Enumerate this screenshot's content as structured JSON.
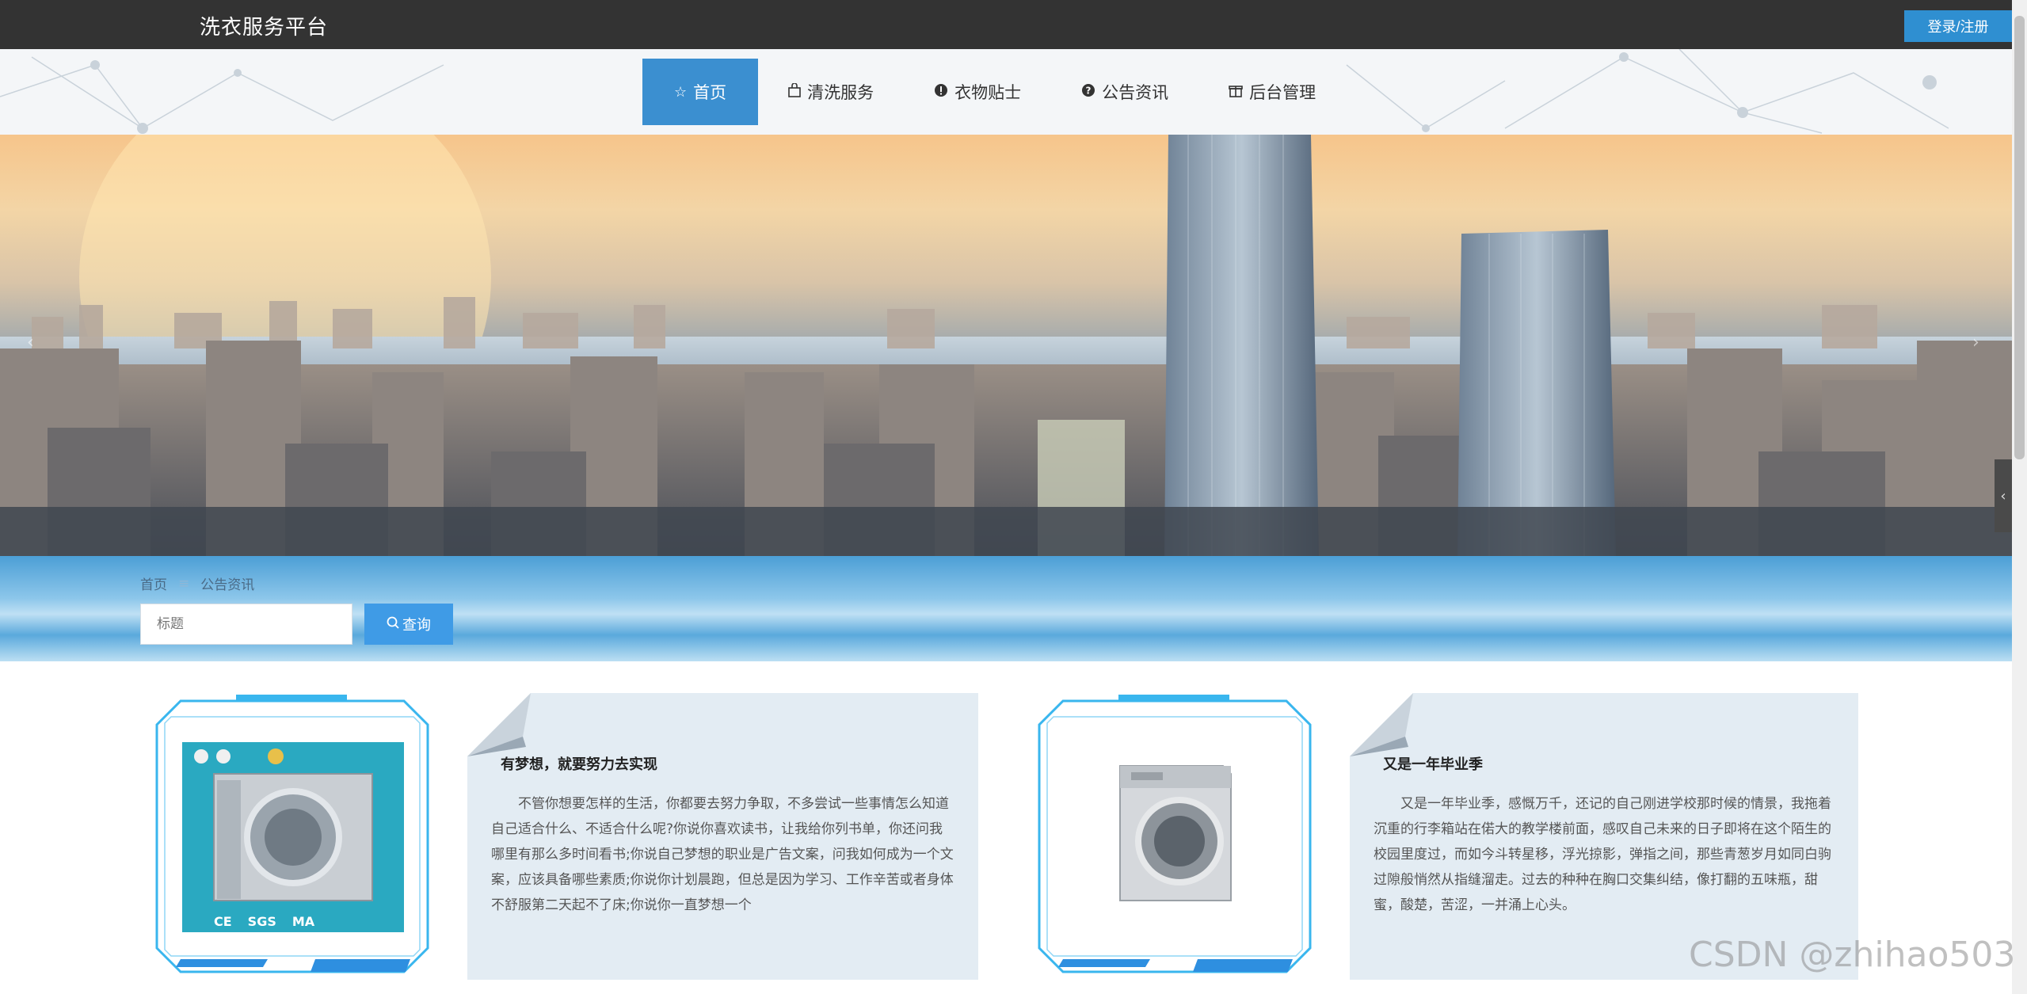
{
  "header": {
    "site_title": "洗衣服务平台",
    "login_label": "登录/注册"
  },
  "nav": {
    "items": [
      {
        "icon": "star-icon",
        "label": "首页",
        "active": true
      },
      {
        "icon": "bag-icon",
        "label": "清洗服务"
      },
      {
        "icon": "info-circle-icon",
        "label": "衣物贴士"
      },
      {
        "icon": "question-circle-icon",
        "label": "公告资讯"
      },
      {
        "icon": "gift-icon",
        "label": "后台管理"
      }
    ]
  },
  "breadcrumb": {
    "home": "首页",
    "separator": "≡",
    "current": "公告资讯"
  },
  "search": {
    "placeholder": "标题",
    "button_label": "查询"
  },
  "articles": [
    {
      "title": "有梦想，就要努力去实现",
      "body": "不管你想要怎样的生活，你都要去努力争取，不多尝试一些事情怎么知道自己适合什么、不适合什么呢?你说你喜欢读书，让我给你列书单，你还问我哪里有那么多时间看书;你说自己梦想的职业是广告文案，问我如何成为一个文案，应该具备哪些素质;你说你计划晨跑，但总是因为学习、工作辛苦或者身体不舒服第二天起不了床;你说你一直梦想一个",
      "image": "industrial-washer",
      "badges": [
        "CE",
        "SGS",
        "MA"
      ]
    },
    {
      "title": "又是一年毕业季",
      "body": "又是一年毕业季，感慨万千，还记的自己刚进学校那时候的情景，我拖着沉重的行李箱站在偌大的教学楼前面，感叹自己未来的日子即将在这个陌生的校园里度过，而如今斗转星移，浮光掠影，弹指之间，那些青葱岁月如同白驹过隙般悄然从指缝溜走。过去的种种在胸口交集纠结，像打翻的五味瓶，甜蜜，酸楚，苦涩，一并涌上心头。",
      "image": "washing-machine"
    }
  ],
  "watermark": "CSDN @zhihao503",
  "colors": {
    "topbar": "#333333",
    "accent": "#3b8fd0",
    "band": "#5aa9dc",
    "card_bg": "#e3ecf3"
  }
}
